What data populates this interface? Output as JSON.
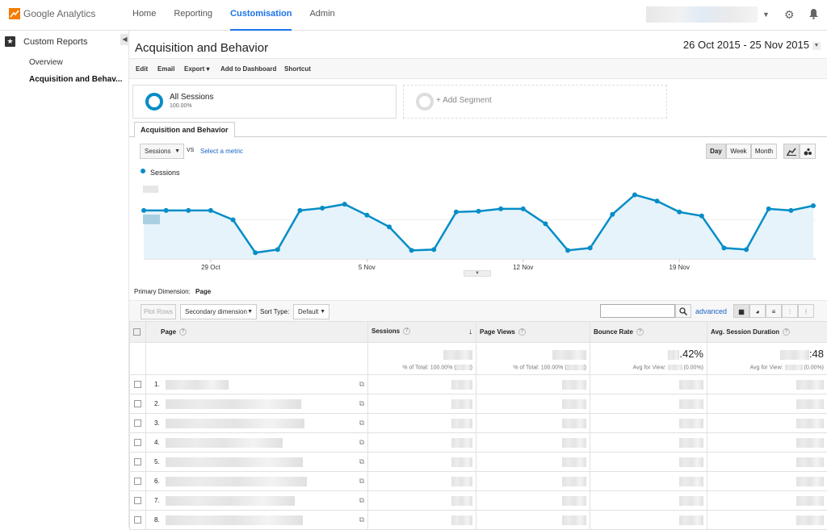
{
  "app": {
    "name": "Google Analytics"
  },
  "nav": [
    {
      "label": "Home",
      "active": false
    },
    {
      "label": "Reporting",
      "active": false
    },
    {
      "label": "Customisation",
      "active": true
    },
    {
      "label": "Admin",
      "active": false
    }
  ],
  "sidebar": {
    "header": "Custom Reports",
    "items": [
      "Overview",
      "Acquisition and Behav..."
    ]
  },
  "report": {
    "title": "Acquisition and Behavior",
    "date_range": "26 Oct 2015 - 25 Nov 2015",
    "actions": [
      "Edit",
      "Email",
      "Export ▾",
      "Add to Dashboard",
      "Shortcut"
    ]
  },
  "segments": {
    "active_name": "All Sessions",
    "active_pct": "100.00%",
    "add_label": "+ Add Segment"
  },
  "tab": "Acquisition and Behavior",
  "chart_controls": {
    "metric": "Sessions",
    "vs": "VS",
    "select_metric": "Select a metric",
    "buttons": [
      "Day",
      "Week",
      "Month"
    ],
    "active_button": "Day"
  },
  "chart_data": {
    "type": "area",
    "series": [
      {
        "name": "Sessions",
        "color": "#058dc7",
        "values": [
          0.62,
          0.62,
          0.62,
          0.62,
          0.5,
          0.08,
          0.12,
          0.62,
          0.65,
          0.7,
          0.56,
          0.41,
          0.11,
          0.12,
          0.6,
          0.61,
          0.64,
          0.64,
          0.45,
          0.11,
          0.14,
          0.57,
          0.82,
          0.74,
          0.6,
          0.55,
          0.14,
          0.12,
          0.64,
          0.62,
          0.68
        ]
      }
    ],
    "x_tick_labels": [
      "29 Oct",
      "5 Nov",
      "12 Nov",
      "19 Nov"
    ],
    "x_tick_index": [
      3,
      10,
      17,
      24
    ]
  },
  "primary_dimension": {
    "label": "Primary Dimension:",
    "value": "Page"
  },
  "table_controls": {
    "plot_rows": "Plot Rows",
    "secondary_dimension": "Secondary dimension",
    "sort_type_label": "Sort Type:",
    "sort_type_value": "Default",
    "advanced": "advanced"
  },
  "table": {
    "headers": [
      "Page",
      "Sessions",
      "Page Views",
      "Bounce Rate",
      "Avg. Session Duration"
    ],
    "totals": {
      "sessions_sub": "% of Total: 100.00% (",
      "pageviews_sub": "% of Total: 100.00% (",
      "bounce_big": ".42%",
      "bounce_sub": "Avg for View:",
      "bounce_sub_end": "(0.00%)",
      "duration_big": ":48",
      "duration_sub": "Avg for View:",
      "duration_sub_end": "(0.00%)"
    },
    "rows": [
      "1.",
      "2.",
      "3.",
      "4.",
      "5.",
      "6.",
      "7.",
      "8."
    ]
  }
}
